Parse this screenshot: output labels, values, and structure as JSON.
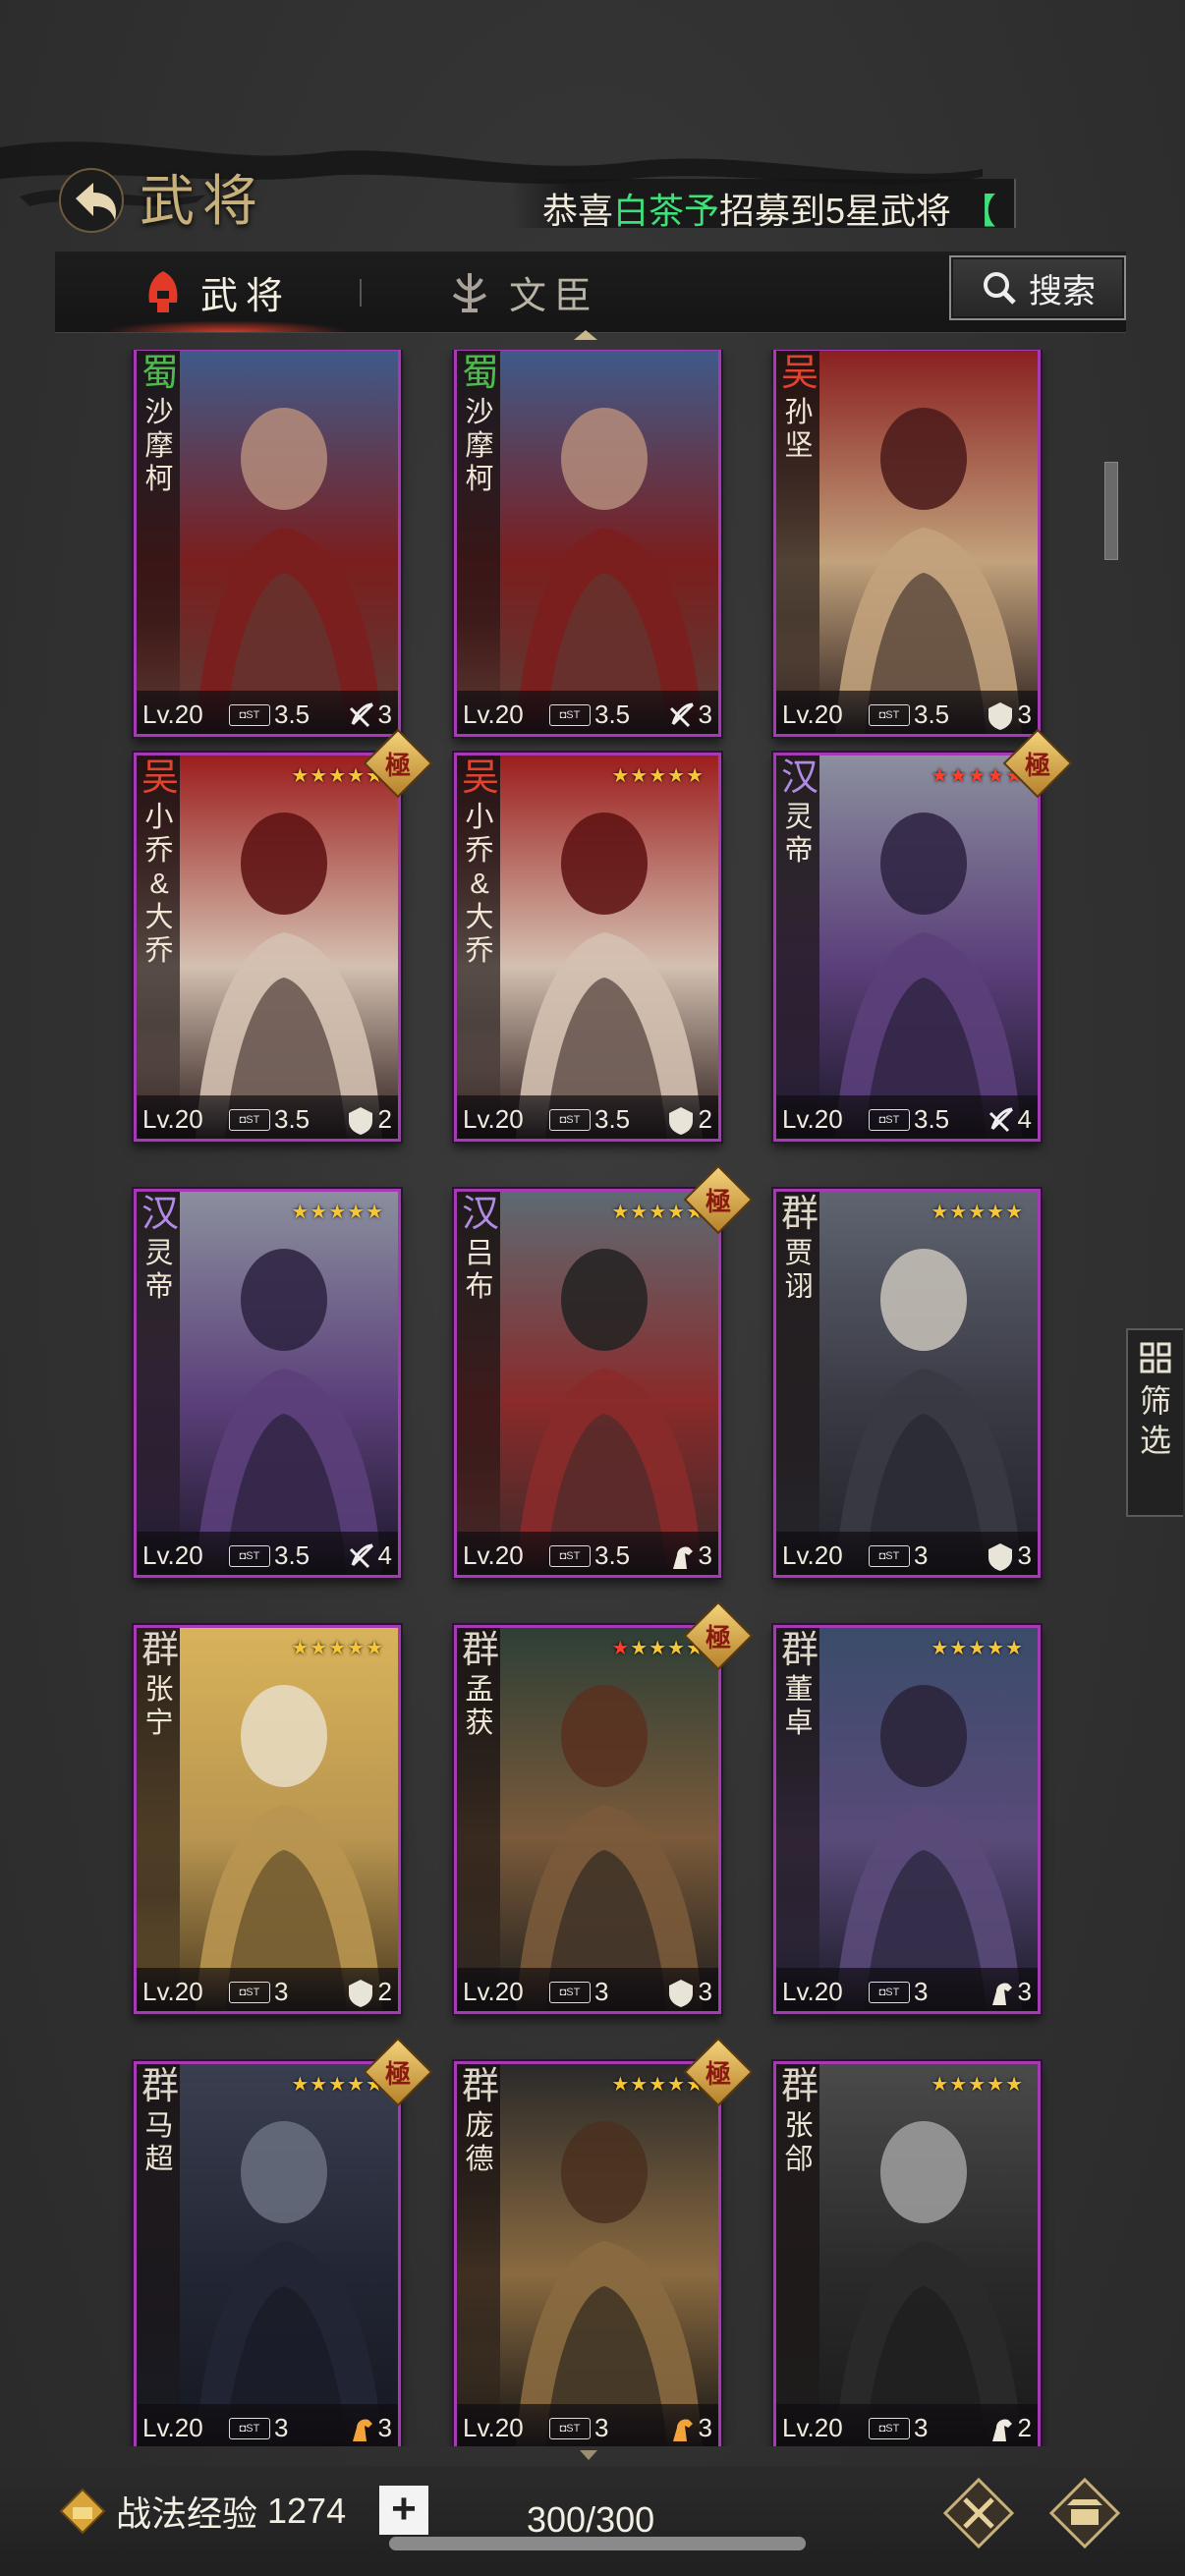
{
  "header": {
    "title": "武将",
    "ticker": {
      "prefix": "恭喜",
      "player": "白茶予",
      "middle": "招募到5星武将",
      "bracket": "【"
    }
  },
  "tabs": [
    {
      "label": "武将",
      "active": true
    },
    {
      "label": "文臣",
      "active": false
    }
  ],
  "search": {
    "label": "搜索"
  },
  "filter": {
    "label": "筛选"
  },
  "cards": [
    {
      "faction": "蜀",
      "name": "沙摩柯",
      "stars": 0,
      "red_stars": 0,
      "badge": "",
      "level": "Lv.20",
      "cost": "3.5",
      "unit_count": "3",
      "unit": "bow",
      "palette": "shamoke"
    },
    {
      "faction": "蜀",
      "name": "沙摩柯",
      "stars": 0,
      "red_stars": 0,
      "badge": "",
      "level": "Lv.20",
      "cost": "3.5",
      "unit_count": "3",
      "unit": "bow",
      "palette": "shamoke"
    },
    {
      "faction": "吴",
      "name": "孙坚",
      "stars": 0,
      "red_stars": 0,
      "badge": "",
      "level": "Lv.20",
      "cost": "3.5",
      "unit_count": "3",
      "unit": "shield",
      "palette": "sunjian"
    },
    {
      "faction": "吴",
      "name": "小乔&大乔",
      "stars": 5,
      "red_stars": 0,
      "badge": "極",
      "level": "Lv.20",
      "cost": "3.5",
      "unit_count": "2",
      "unit": "shield",
      "palette": "qiao"
    },
    {
      "faction": "吴",
      "name": "小乔&大乔",
      "stars": 5,
      "red_stars": 0,
      "badge": "",
      "level": "Lv.20",
      "cost": "3.5",
      "unit_count": "2",
      "unit": "shield",
      "palette": "qiao"
    },
    {
      "faction": "汉",
      "name": "灵帝",
      "stars": 5,
      "red_stars": 5,
      "badge": "極",
      "level": "Lv.20",
      "cost": "3.5",
      "unit_count": "4",
      "unit": "bow",
      "palette": "lingdi"
    },
    {
      "faction": "汉",
      "name": "灵帝",
      "stars": 5,
      "red_stars": 0,
      "badge": "",
      "level": "Lv.20",
      "cost": "3.5",
      "unit_count": "4",
      "unit": "bow",
      "palette": "lingdi"
    },
    {
      "faction": "汉",
      "name": "吕布",
      "stars": 5,
      "red_stars": 0,
      "badge": "極",
      "level": "Lv.20",
      "cost": "3.5",
      "unit_count": "3",
      "unit": "horse",
      "palette": "lvbu"
    },
    {
      "faction": "群",
      "name": "贾诩",
      "stars": 5,
      "red_stars": 0,
      "badge": "",
      "level": "Lv.20",
      "cost": "3",
      "unit_count": "3",
      "unit": "shield",
      "palette": "jiaxu"
    },
    {
      "faction": "群",
      "name": "张宁",
      "stars": 5,
      "red_stars": 0,
      "badge": "",
      "level": "Lv.20",
      "cost": "3",
      "unit_count": "2",
      "unit": "shield",
      "palette": "zhangning"
    },
    {
      "faction": "群",
      "name": "孟获",
      "stars": 5,
      "red_stars": 1,
      "badge": "極",
      "level": "Lv.20",
      "cost": "3",
      "unit_count": "3",
      "unit": "shield",
      "palette": "menghuo"
    },
    {
      "faction": "群",
      "name": "董卓",
      "stars": 5,
      "red_stars": 0,
      "badge": "",
      "level": "Lv.20",
      "cost": "3",
      "unit_count": "3",
      "unit": "horse",
      "palette": "dongzhuo"
    },
    {
      "faction": "群",
      "name": "马超",
      "stars": 5,
      "red_stars": 0,
      "badge": "極",
      "level": "Lv.20",
      "cost": "3",
      "unit_count": "3",
      "unit": "horse-orange",
      "palette": "machao"
    },
    {
      "faction": "群",
      "name": "庞德",
      "stars": 5,
      "red_stars": 0,
      "badge": "極",
      "level": "Lv.20",
      "cost": "3",
      "unit_count": "3",
      "unit": "horse-orange",
      "palette": "pangde"
    },
    {
      "faction": "群",
      "name": "张郃",
      "stars": 5,
      "red_stars": 0,
      "badge": "",
      "level": "Lv.20",
      "cost": "3",
      "unit_count": "2",
      "unit": "horse",
      "palette": "zhanghe"
    }
  ],
  "palettes": {
    "shamoke": [
      "#3f5a8a",
      "#7b1e1e",
      "#b58c7a",
      "#5a3e36"
    ],
    "sunjian": [
      "#8a2020",
      "#c2a27c",
      "#4a1a1a",
      "#2a1d1d"
    ],
    "qiao": [
      "#9c1e1e",
      "#d4c0b0",
      "#5c1010",
      "#2a1a1a"
    ],
    "lingdi": [
      "#8b8f9e",
      "#5b3f7a",
      "#2d2240",
      "#1c1828"
    ],
    "lvbu": [
      "#5d6a72",
      "#8a2a2a",
      "#222",
      "#3a2a2a"
    ],
    "jiaxu": [
      "#5e6470",
      "#3a3a44",
      "#c9c3ba",
      "#22222a"
    ],
    "zhangning": [
      "#d9b35a",
      "#b89550",
      "#e8ddc6",
      "#4a3a20"
    ],
    "menghuo": [
      "#2e3f36",
      "#7a5a3a",
      "#5a3020",
      "#1e1e1e"
    ],
    "dongzhuo": [
      "#3a4c6a",
      "#5a4a7a",
      "#2a2238",
      "#1a1a26"
    ],
    "machao": [
      "#3a3f50",
      "#222634",
      "#6a7080",
      "#151820"
    ],
    "pangde": [
      "#2a2a2a",
      "#8a6a40",
      "#4a3020",
      "#151515"
    ],
    "zhanghe": [
      "#4a4a4a",
      "#2a2a2a",
      "#a0a0a0",
      "#1a1a1a"
    ]
  },
  "bottom": {
    "skill_exp_label": "战法经验",
    "skill_exp_value": "1274",
    "plus": "+",
    "count": "300/300",
    "count_fraction": 1
  }
}
